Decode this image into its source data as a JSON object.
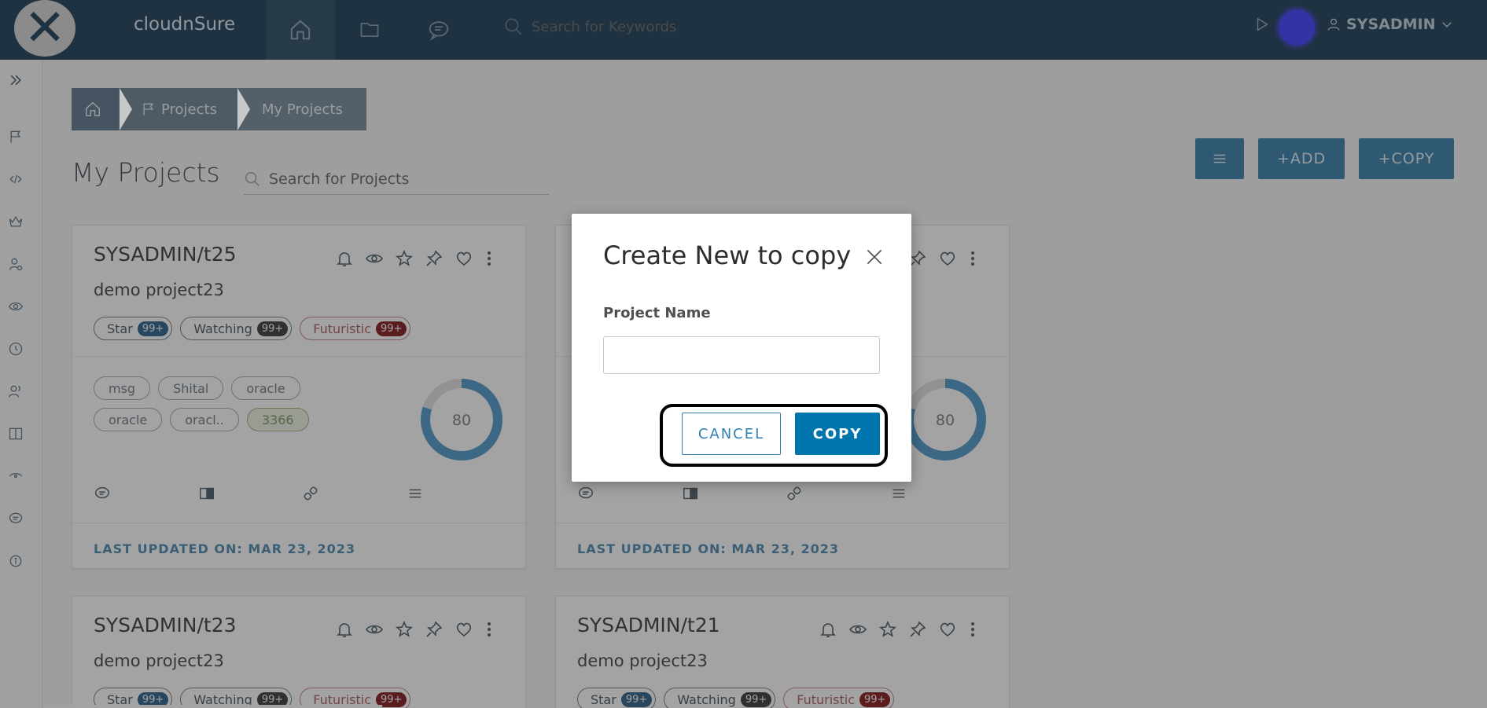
{
  "app": {
    "brand": "cloudnSure",
    "logo_icon": "cloudnsure-logo-icon"
  },
  "topbar": {
    "search_placeholder": "Search for Keywords",
    "user_label": "SYSADMIN"
  },
  "breadcrumb": {
    "items": [
      {
        "label": ""
      },
      {
        "label": "Projects"
      },
      {
        "label": "My Projects"
      }
    ]
  },
  "page": {
    "title": "My Projects",
    "search_placeholder": "Search for Projects",
    "add_label": "+ADD",
    "copy_label": "+COPY"
  },
  "cards": [
    {
      "title": "SYSADMIN/t25",
      "description": "demo project23",
      "pills": [
        {
          "label": "Star",
          "count": "99+"
        },
        {
          "label": "Watching",
          "count": "99+"
        },
        {
          "label": "Futuristic",
          "count": "99+"
        }
      ],
      "tags": [
        "msg",
        "Shital",
        "oracle",
        "oracle",
        "oracl..",
        "3366"
      ],
      "donut_value": "80",
      "updated": "LAST UPDATED ON: MAR 23, 2023"
    },
    {
      "title": "",
      "description": "",
      "donut_value": "80",
      "updated": "LAST UPDATED ON: MAR 23, 2023"
    },
    {
      "title": "SYSADMIN/t23",
      "description": "demo project23",
      "pills": [
        {
          "label": "Star",
          "count": "99+"
        },
        {
          "label": "Watching",
          "count": "99+"
        },
        {
          "label": "Futuristic",
          "count": "99+"
        }
      ]
    },
    {
      "title": "SYSADMIN/t21",
      "description": "demo project23",
      "pills": [
        {
          "label": "Star",
          "count": "99+"
        },
        {
          "label": "Watching",
          "count": "99+"
        },
        {
          "label": "Futuristic",
          "count": "99+"
        }
      ]
    }
  ],
  "modal": {
    "title": "Create New to copy",
    "field_label": "Project Name",
    "field_value": "",
    "cancel_label": "CANCEL",
    "copy_label": "COPY"
  },
  "colors": {
    "topbar": "#2f4f66",
    "primary": "#0074ad",
    "accent": "#4a8bb3"
  }
}
